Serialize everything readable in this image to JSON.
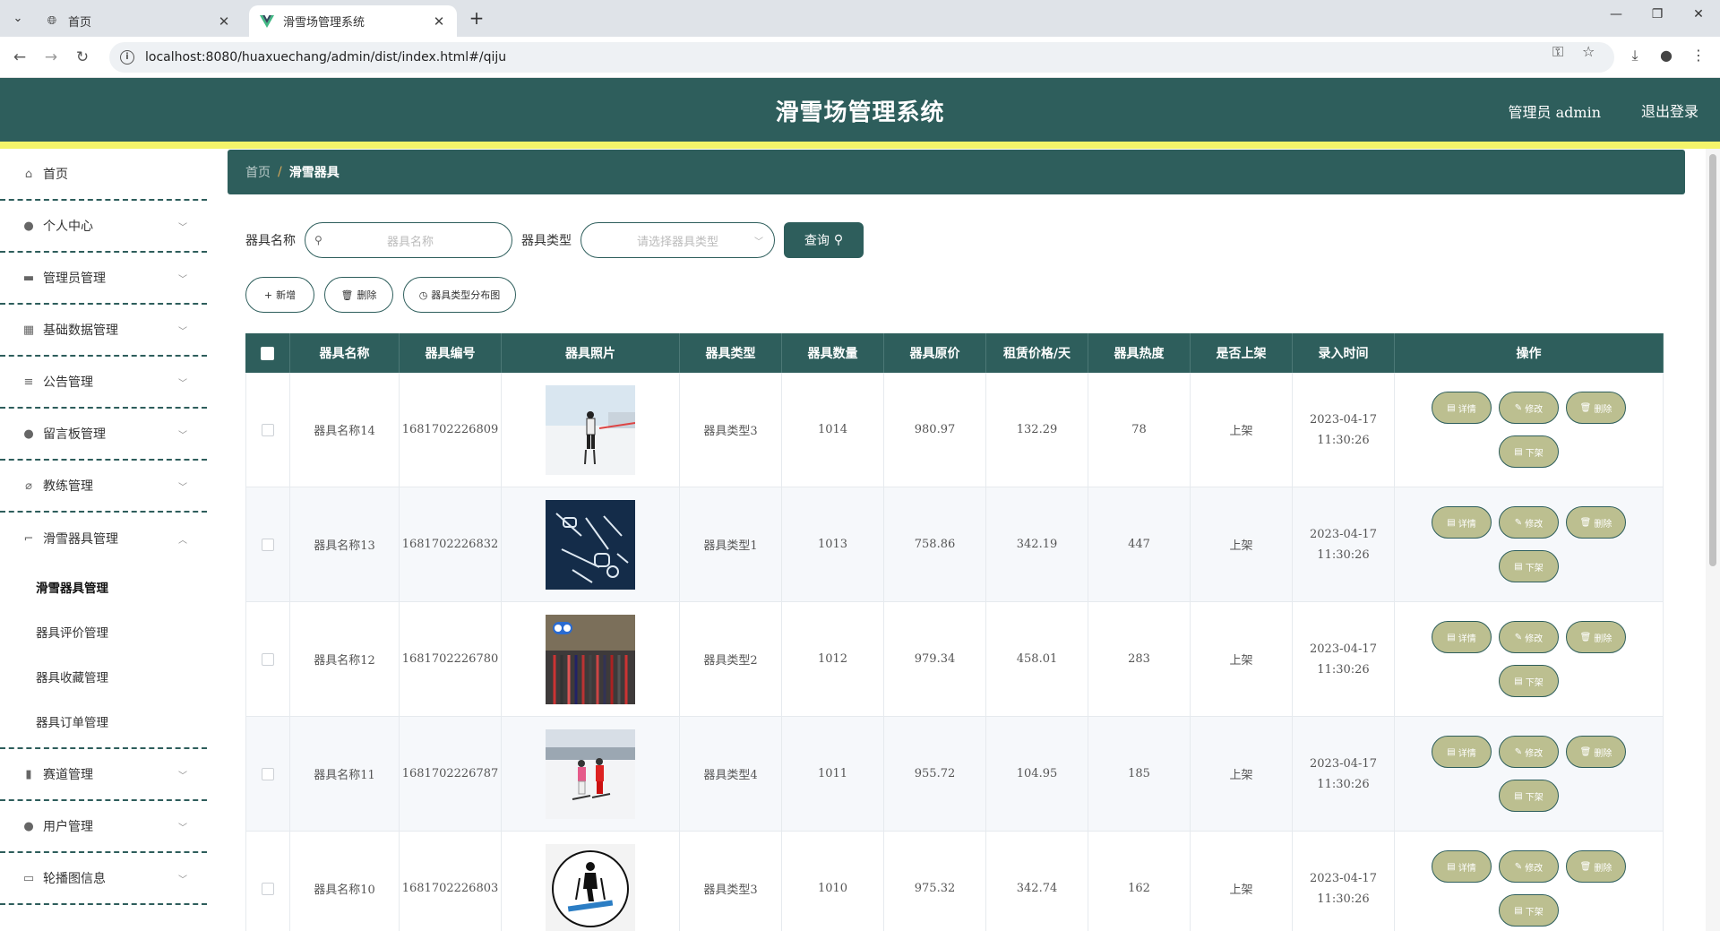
{
  "browser": {
    "tabs": [
      {
        "title": "首页",
        "active": false,
        "icon": "globe-icon"
      },
      {
        "title": "滑雪场管理系统",
        "active": true,
        "icon": "vue-icon"
      }
    ],
    "url": "localhost:8080/huaxuechang/admin/dist/index.html#/qiju"
  },
  "header": {
    "title": "滑雪场管理系统",
    "user": "管理员 admin",
    "logout": "退出登录"
  },
  "sidebar": {
    "items": [
      {
        "label": "首页",
        "icon": "home-icon"
      },
      {
        "label": "个人中心",
        "icon": "user-icon"
      },
      {
        "label": "管理员管理",
        "icon": "chat-icon"
      },
      {
        "label": "基础数据管理",
        "icon": "grid-icon"
      },
      {
        "label": "公告管理",
        "icon": "sliders-icon"
      },
      {
        "label": "留言板管理",
        "icon": "bulb-icon"
      },
      {
        "label": "教练管理",
        "icon": "no-bell-icon"
      },
      {
        "label": "滑雪器具管理",
        "icon": "crop-icon"
      },
      {
        "label": "赛道管理",
        "icon": "bar-chart-icon"
      },
      {
        "label": "用户管理",
        "icon": "user-icon"
      },
      {
        "label": "轮播图信息",
        "icon": "card-icon"
      }
    ],
    "submenu": [
      "滑雪器具管理",
      "器具评价管理",
      "器具收藏管理",
      "器具订单管理"
    ]
  },
  "breadcrumb": {
    "home": "首页",
    "sep": "/",
    "current": "滑雪器具"
  },
  "search": {
    "name_label": "器具名称",
    "name_placeholder": "器具名称",
    "type_label": "器具类型",
    "type_placeholder": "请选择器具类型",
    "query_button": "查询"
  },
  "actions": {
    "add": "新增",
    "delete": "删除",
    "chart": "器具类型分布图"
  },
  "table": {
    "headers": [
      "器具名称",
      "器具编号",
      "器具照片",
      "器具类型",
      "器具数量",
      "器具原价",
      "租赁价格/天",
      "器具热度",
      "是否上架",
      "录入时间",
      "操作"
    ],
    "row_actions": {
      "detail": "详情",
      "edit": "修改",
      "delete": "删除",
      "offline": "下架"
    },
    "rows": [
      {
        "name": "器具名称14",
        "code": "1681702226809",
        "type": "器具类型3",
        "count": "1014",
        "price": "980.97",
        "rent": "132.29",
        "hot": "78",
        "on_sale": "上架",
        "time": "2023-04-17 11:30:26",
        "photo": "skier-snow"
      },
      {
        "name": "器具名称13",
        "code": "1681702226832",
        "type": "器具类型1",
        "count": "1013",
        "price": "758.86",
        "rent": "342.19",
        "hot": "447",
        "on_sale": "上架",
        "time": "2023-04-17 11:30:26",
        "photo": "ski-gear-flatlay"
      },
      {
        "name": "器具名称12",
        "code": "1681702226780",
        "type": "器具类型2",
        "count": "1012",
        "price": "979.34",
        "rent": "458.01",
        "hot": "283",
        "on_sale": "上架",
        "time": "2023-04-17 11:30:26",
        "photo": "ski-rental-shop"
      },
      {
        "name": "器具名称11",
        "code": "1681702226787",
        "type": "器具类型4",
        "count": "1011",
        "price": "955.72",
        "rent": "104.95",
        "hot": "185",
        "on_sale": "上架",
        "time": "2023-04-17 11:30:26",
        "photo": "two-skiers"
      },
      {
        "name": "器具名称10",
        "code": "1681702226803",
        "type": "器具类型3",
        "count": "1010",
        "price": "975.32",
        "rent": "342.74",
        "hot": "162",
        "on_sale": "上架",
        "time": "2023-04-17 11:30:26",
        "photo": "skier-icon-circle"
      }
    ]
  }
}
